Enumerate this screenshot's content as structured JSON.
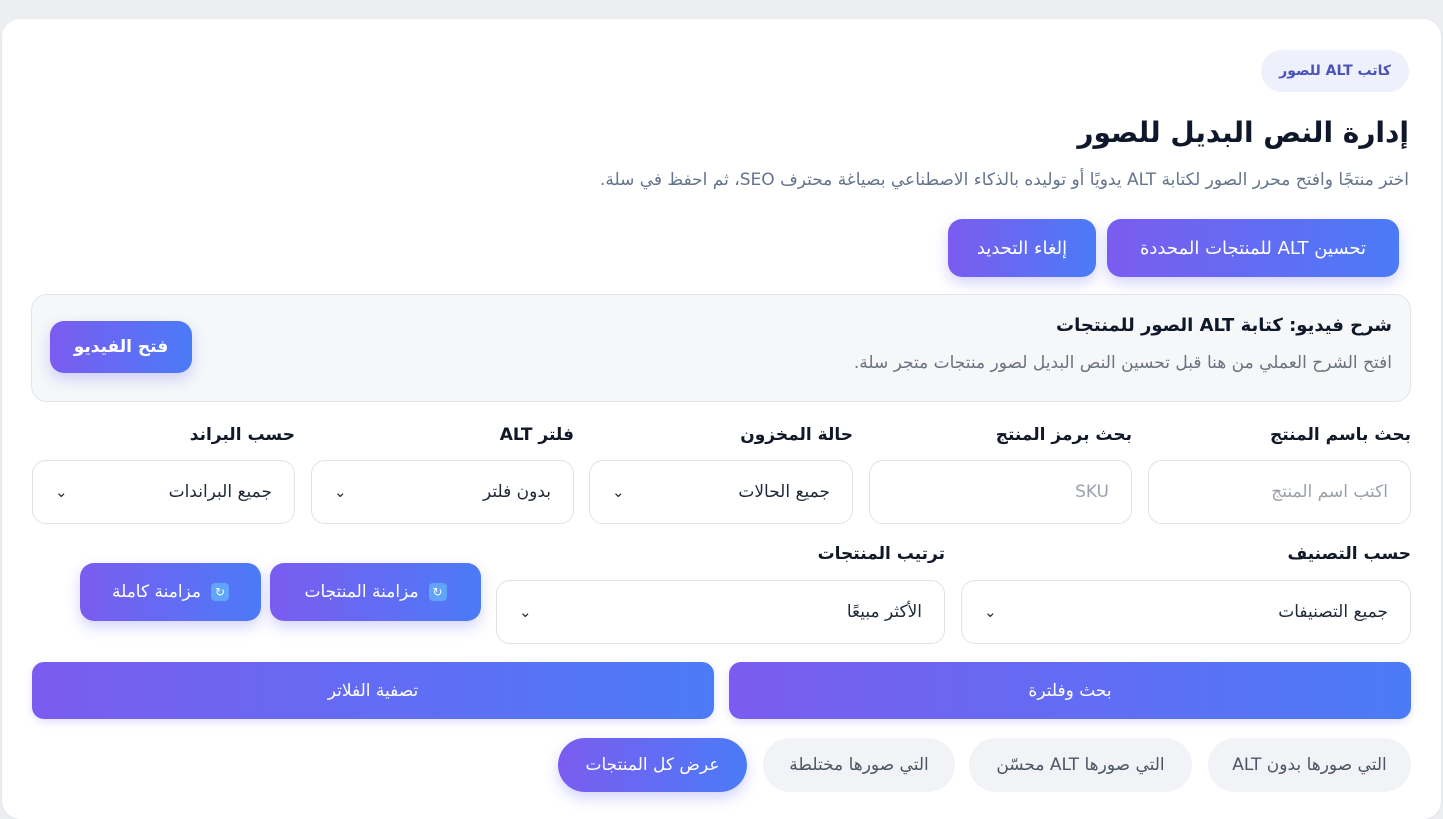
{
  "header": {
    "badge": "كاتب ALT للصور",
    "title": "إدارة النص البديل للصور",
    "subtitle": "اختر منتجًا وافتح محرر الصور لكتابة ALT يدويًا أو توليده بالذكاء الاصطناعي بصياغة محترف SEO، ثم احفظ في سلة."
  },
  "actions": {
    "improve_selected": "تحسين ALT للمنتجات المحددة",
    "cancel_selection": "إلغاء التحديد"
  },
  "video": {
    "title": "شرح فيديو: كتابة ALT الصور للمنتجات",
    "description": "افتح الشرح العملي من هنا قبل تحسين النص البديل لصور منتجات متجر سلة.",
    "button": "فتح الفيديو"
  },
  "filters": {
    "name_search": {
      "label": "بحث باسم المنتج",
      "placeholder": "اكتب اسم المنتج"
    },
    "sku_search": {
      "label": "بحث برمز المنتج",
      "placeholder": "SKU"
    },
    "stock": {
      "label": "حالة المخزون",
      "value": "جميع الحالات"
    },
    "alt_filter": {
      "label": "فلتر ALT",
      "value": "بدون فلتر"
    },
    "brand": {
      "label": "حسب البراند",
      "value": "جميع البراندات"
    },
    "category": {
      "label": "حسب التصنيف",
      "value": "جميع التصنيفات"
    },
    "sort": {
      "label": "ترتيب المنتجات",
      "value": "الأكثر مبيعًا"
    }
  },
  "sync": {
    "products": "مزامنة المنتجات",
    "full": "مزامنة كاملة"
  },
  "buttons": {
    "search": "بحث وفلترة",
    "clear": "تصفية الفلاتر"
  },
  "pills": [
    "التي صورها بدون ALT",
    "التي صورها ALT محسّن",
    "التي صورها مختلطة",
    "عرض كل المنتجات"
  ],
  "colors": {
    "accent_start": "#7b5cf0",
    "accent_end": "#4b7bf7",
    "badge_bg": "#eef0fb",
    "page_bg": "#eceef2"
  },
  "icons": {
    "chevron": "chevron-down-icon",
    "sync": "sync-icon"
  }
}
